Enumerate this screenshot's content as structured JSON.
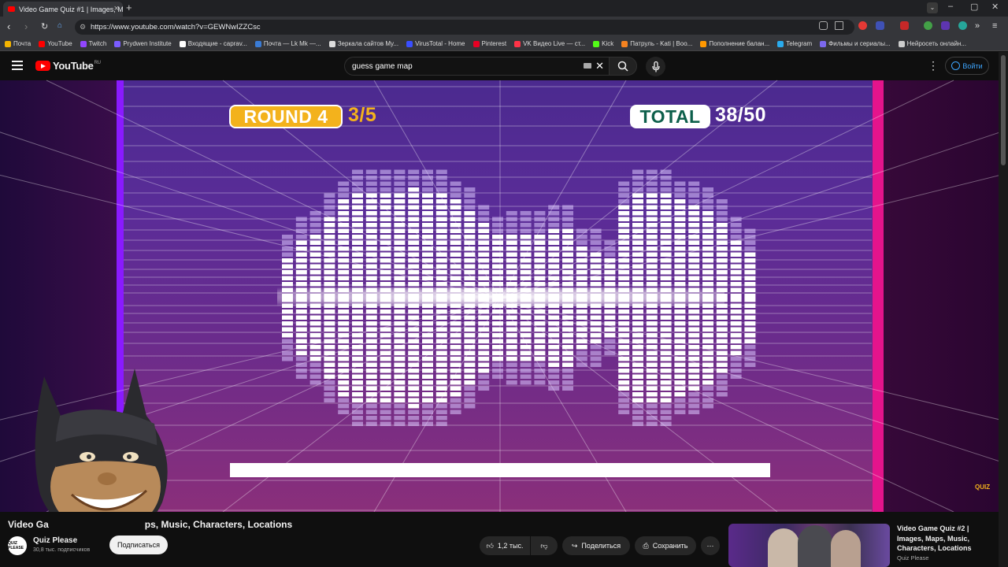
{
  "browser": {
    "tab_title": "Video Game Quiz #1 | Images, M",
    "url": "https://www.youtube.com/watch?v=GEWNwIZZCsc",
    "bookmarks": [
      {
        "label": "Почта",
        "color": "#f4b400"
      },
      {
        "label": "YouTube",
        "color": "#ff0000"
      },
      {
        "label": "Twitch",
        "color": "#9146ff"
      },
      {
        "label": "Prydwen Institute",
        "color": "#7a5cff"
      },
      {
        "label": "Входящие - caprav...",
        "color": "#ffffff"
      },
      {
        "label": "Почта — Lk Mk —...",
        "color": "#3a7bd5"
      },
      {
        "label": "Зеркала сайтов My...",
        "color": "#dddddd"
      },
      {
        "label": "VirusTotal - Home",
        "color": "#394eff"
      },
      {
        "label": "Pinterest",
        "color": "#e60023"
      },
      {
        "label": "VK Видео Live — ст...",
        "color": "#ff3347"
      },
      {
        "label": "Kick",
        "color": "#53fc18"
      },
      {
        "label": "Патруль - Kati | Boo...",
        "color": "#f58220"
      },
      {
        "label": "Пополнение балан...",
        "color": "#ff9800"
      },
      {
        "label": "Telegram",
        "color": "#2aabee"
      },
      {
        "label": "Фильмы и сериалы...",
        "color": "#7b68ee"
      },
      {
        "label": "Нейросеть онлайн...",
        "color": "#cccccc"
      }
    ]
  },
  "youtube": {
    "logo_text": "YouTube",
    "region": "RU",
    "search_value": "guess game map",
    "signin_label": "Войти"
  },
  "video": {
    "round_label": "ROUND 4",
    "round_value": "3/5",
    "total_label": "TOTAL",
    "total_value": "38/50",
    "watermark": "QUIZ",
    "colors": {
      "accent": "#f3b21c",
      "left_border": "#8a1aff",
      "right_border": "#e4148c"
    }
  },
  "info": {
    "title_start": "Video Ga",
    "title_end": "ps, Music, Characters, Locations",
    "channel": "Quiz Please",
    "channel_avatar": "QUIZ PLEASE",
    "subscribers": "30,8 тыс. подписчиков",
    "subscribe_label": "Подписаться",
    "likes": "1,2 тыс.",
    "share_label": "Поделиться",
    "save_label": "Сохранить"
  },
  "related": {
    "title": "Video Game Quiz #2 | Images, Maps, Music, Characters, Locations",
    "channel": "Quiz Please"
  }
}
